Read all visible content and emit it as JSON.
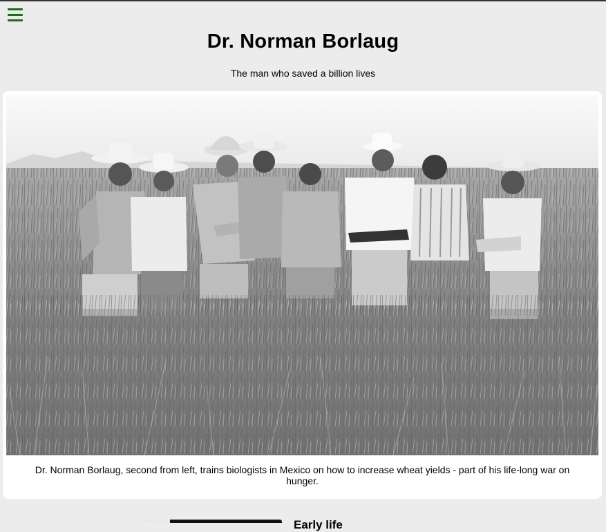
{
  "nav": {
    "menu_icon": "hamburger-menu-icon",
    "accent_color": "#1d6b1d"
  },
  "header": {
    "title": "Dr. Norman Borlaug",
    "subtitle": "The man who saved a billion lives"
  },
  "figure": {
    "caption": "Dr. Norman Borlaug, second from left, trains biologists in Mexico on how to increase wheat yields - part of his life-long war on hunger."
  },
  "next_section": {
    "heading": "Early life"
  }
}
